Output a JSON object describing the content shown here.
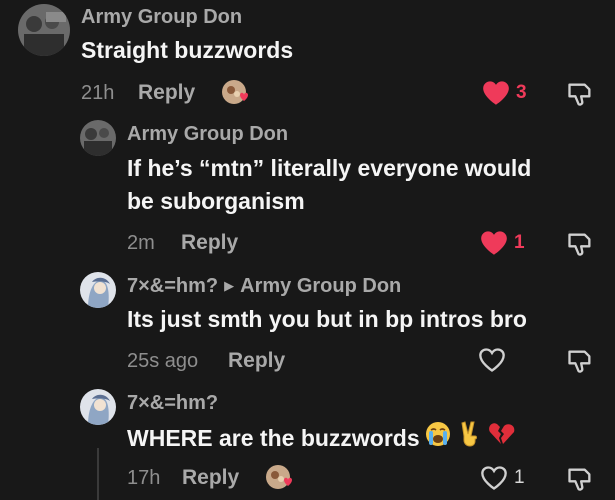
{
  "comments": [
    {
      "author": "Army Group Don",
      "text": "Straight buzzwords",
      "time": "21h",
      "reply_label": "Reply",
      "likes": "3",
      "liked": true
    },
    {
      "author": "Army Group Don",
      "text_line1": "If he’s “mtn” literally everyone would",
      "text_line2": "be suborganism",
      "time": "2m",
      "reply_label": "Reply",
      "likes": "1",
      "liked": true
    },
    {
      "author": "7×&=hm?",
      "reply_to": "Army Group Don",
      "text": "Its just smth you but in bp intros bro",
      "time": "25s ago",
      "reply_label": "Reply",
      "likes": "",
      "liked": false
    },
    {
      "author": "7×&=hm?",
      "text": "WHERE are the buzzwords",
      "time": "17h",
      "reply_label": "Reply",
      "likes": "1",
      "liked": false
    }
  ],
  "icons": {
    "heart_filled": "heart-icon",
    "heart_outline": "heart-outline-icon",
    "dislike": "thumbs-down-icon",
    "emojis": [
      "loudly-crying-face",
      "victory-hand",
      "broken-heart"
    ]
  },
  "colors": {
    "background": "#181818",
    "liked": "#ef3a5a",
    "author": "#a9a9a9",
    "text": "#f5f5f5"
  }
}
